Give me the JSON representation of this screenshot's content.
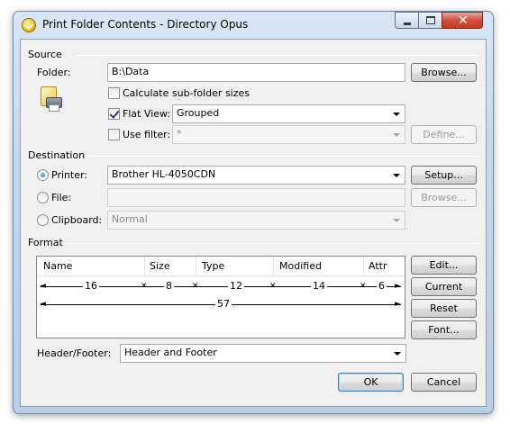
{
  "window": {
    "title": "Print Folder Contents - Directory Opus"
  },
  "source": {
    "section_label": "Source",
    "folder_label": "Folder:",
    "folder_value": "B:\\Data",
    "browse_label": "Browse...",
    "calc_subfolder_label": "Calculate sub-folder sizes",
    "calc_subfolder_checked": false,
    "flat_view_label": "Flat View:",
    "flat_view_checked": true,
    "flat_view_value": "Grouped",
    "use_filter_label": "Use filter:",
    "use_filter_checked": false,
    "filter_value": "*",
    "define_label": "Define..."
  },
  "destination": {
    "section_label": "Destination",
    "printer_label": "Printer:",
    "printer_value": "Brother HL-4050CDN",
    "setup_label": "Setup...",
    "file_label": "File:",
    "file_value": "",
    "file_browse_label": "Browse...",
    "clipboard_label": "Clipboard:",
    "clipboard_value": "Normal",
    "selected": "printer"
  },
  "format": {
    "section_label": "Format",
    "columns": [
      "Name",
      "Size",
      "Type",
      "Modified",
      "Attr"
    ],
    "widths": [
      "16",
      "8",
      "12",
      "14",
      "6"
    ],
    "total_width": "57",
    "edit_label": "Edit...",
    "current_label": "Current",
    "reset_label": "Reset",
    "font_label": "Font...",
    "header_footer_label": "Header/Footer:",
    "header_footer_value": "Header and Footer"
  },
  "footer": {
    "ok_label": "OK",
    "cancel_label": "Cancel"
  }
}
